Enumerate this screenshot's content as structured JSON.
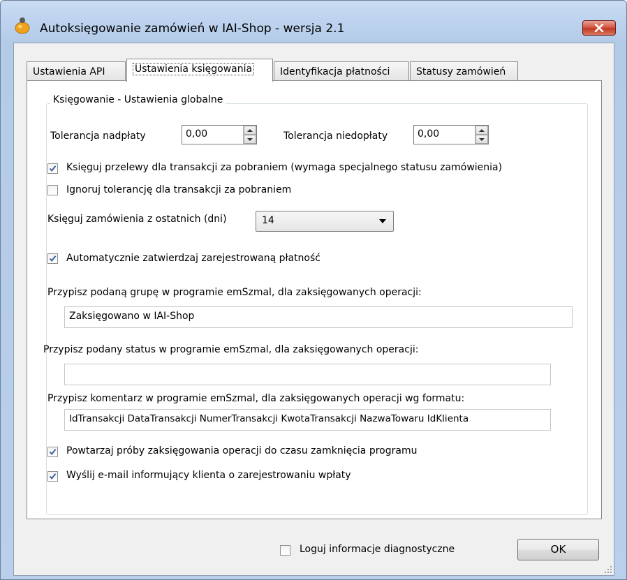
{
  "window": {
    "title": "Autoksięgowanie zamówień w IAI-Shop - wersja 2.1",
    "icon": "app-icon",
    "close_label": "close"
  },
  "tabs": [
    {
      "label": "Ustawienia API",
      "active": false
    },
    {
      "label": "Ustawienia księgowania",
      "active": true
    },
    {
      "label": "Identyfikacja płatności",
      "active": false
    },
    {
      "label": "Statusy zamówień",
      "active": false
    }
  ],
  "group": {
    "legend": "Księgowanie - Ustawienia globalne"
  },
  "tolerances": {
    "overpay_label": "Tolerancja nadpłaty",
    "overpay_value": "0,00",
    "underpay_label": "Tolerancja niedopłaty",
    "underpay_value": "0,00"
  },
  "checkboxes": {
    "cod_transfers": {
      "label": "Księguj przelewy dla transakcji za pobraniem (wymaga specjalnego statusu zamówienia)",
      "checked": true
    },
    "ignore_tolerance": {
      "label": "Ignoruj tolerancję dla transakcji za pobraniem",
      "checked": false
    },
    "auto_confirm": {
      "label": "Automatycznie zatwierdzaj zarejestrowaną płatność",
      "checked": true
    },
    "retry": {
      "label": "Powtarzaj próby zaksięgowania operacji do czasu zamknięcia programu",
      "checked": true
    },
    "send_email": {
      "label": "Wyślij e-mail informujący klienta o zarejestrowaniu wpłaty",
      "checked": true
    },
    "log_diag": {
      "label": "Loguj informacje diagnostyczne",
      "checked": false
    }
  },
  "days": {
    "label": "Księguj zamówienia z ostatnich (dni)",
    "value": "14"
  },
  "group_field": {
    "label": "Przypisz podaną grupę w programie emSzmal, dla zaksięgowanych operacji:",
    "value": "Zaksięgowano w IAI-Shop"
  },
  "status_field": {
    "label": "Przypisz podany status w programie emSzmal, dla zaksięgowanych operacji:",
    "value": ""
  },
  "comment_field": {
    "label": "Przypisz komentarz w programie emSzmal, dla zaksięgowanych operacji wg formatu:",
    "value": "IdTransakcji DataTransakcji NumerTransakcji KwotaTransakcji NazwaTowaru IdKlienta"
  },
  "footer": {
    "ok_label": "OK"
  },
  "colors": {
    "titlebar": "#bdd3ee",
    "close": "#c03a25",
    "check": "#3a5f9f"
  }
}
